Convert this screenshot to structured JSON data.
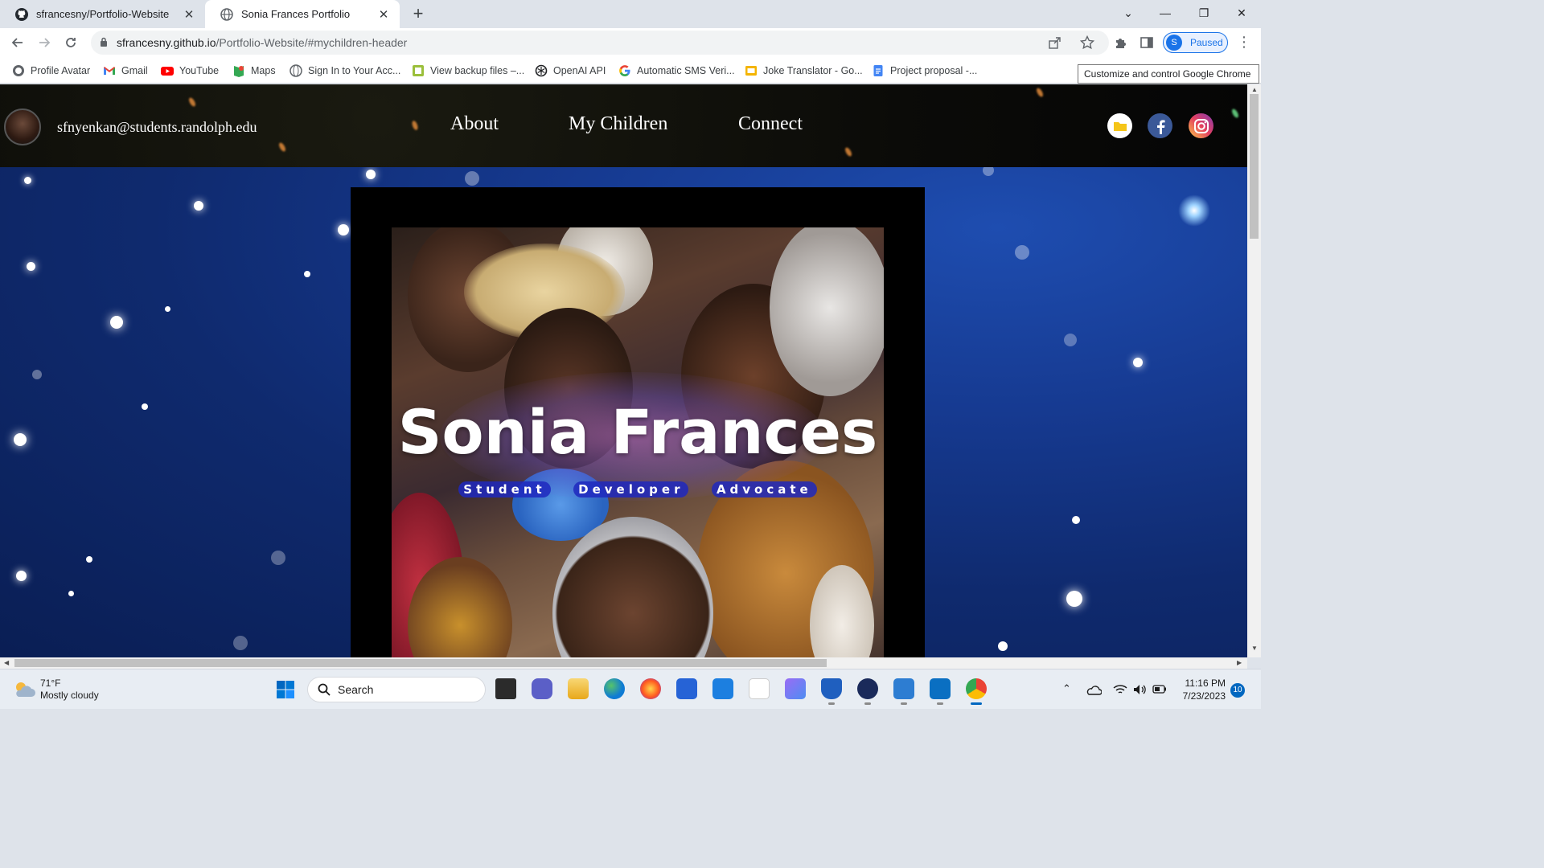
{
  "browser": {
    "tabs": [
      {
        "title": "sfrancesny/Portfolio-Website",
        "favicon": "github-icon",
        "active": false
      },
      {
        "title": "Sonia Frances Portfolio",
        "favicon": "globe-icon",
        "active": true
      }
    ],
    "url_host": "sfrancesny.github.io",
    "url_path": "/Portfolio-Website/#mychildren-header",
    "profile_initial": "S",
    "profile_status": "Paused",
    "tooltip": "Customize and control Google Chrome",
    "bookmarks": [
      {
        "label": "Profile Avatar",
        "icon": "globe-icon"
      },
      {
        "label": "Gmail",
        "icon": "gmail-icon"
      },
      {
        "label": "YouTube",
        "icon": "youtube-icon"
      },
      {
        "label": "Maps",
        "icon": "maps-icon"
      },
      {
        "label": "Sign In to Your Acc...",
        "icon": "globe-icon"
      },
      {
        "label": "View backup files –...",
        "icon": "backup-icon"
      },
      {
        "label": "OpenAI API",
        "icon": "openai-icon"
      },
      {
        "label": "Automatic SMS Veri...",
        "icon": "google-icon"
      },
      {
        "label": "Joke Translator - Go...",
        "icon": "slides-icon"
      },
      {
        "label": "Project proposal -...",
        "icon": "docs-icon"
      }
    ]
  },
  "site": {
    "email": "sfnyenkan@students.randolph.edu",
    "nav": [
      "About",
      "My Children",
      "Connect"
    ],
    "social": [
      {
        "name": "folder-icon",
        "color": "#ffffff"
      },
      {
        "name": "facebook-icon",
        "color": "#3b5998"
      },
      {
        "name": "instagram-icon",
        "color": "#d6249f"
      }
    ],
    "hero_title": "Sonia Frances",
    "roles": [
      "Student",
      "Developer",
      "Advocate"
    ]
  },
  "taskbar": {
    "weather_temp": "71°F",
    "weather_desc": "Mostly cloudy",
    "search_label": "Search",
    "time": "11:16 PM",
    "date": "7/23/2023",
    "notifications": "10"
  },
  "colors": {
    "accent": "#1a73e8",
    "space_blue": "#163a91",
    "role_badge": "#1e28be"
  }
}
